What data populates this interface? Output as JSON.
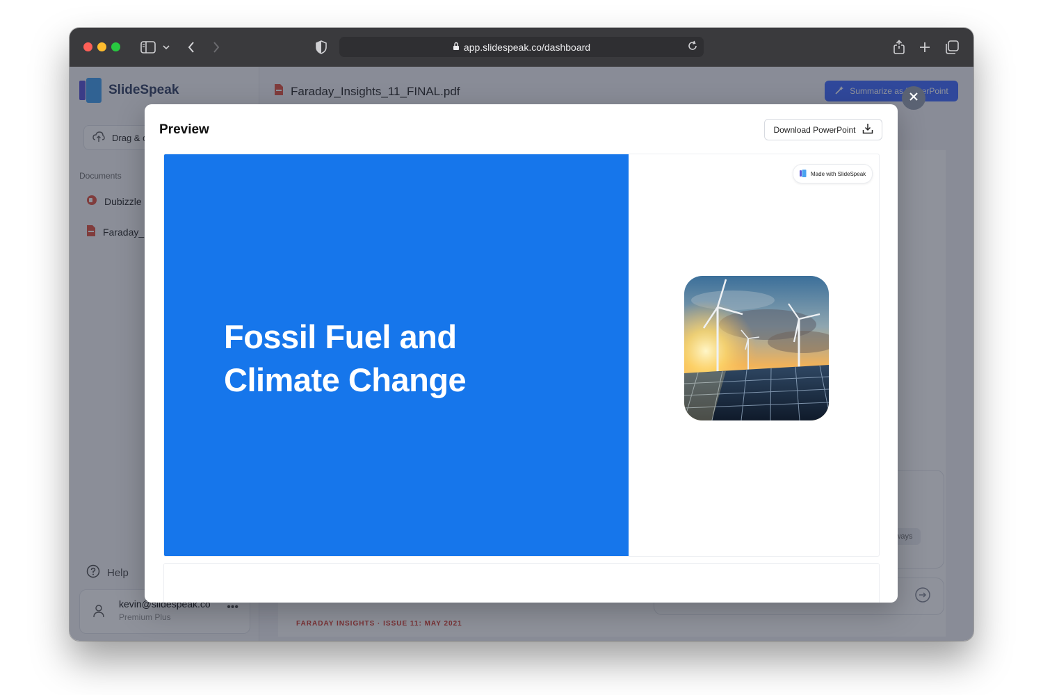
{
  "browser": {
    "url": "app.slidespeak.co/dashboard"
  },
  "sidebar": {
    "app_name": "SlideSpeak",
    "upload_label": "Drag & d",
    "documents_heading": "Documents",
    "documents": [
      {
        "name": "Dubizzle",
        "color": "#e25b4a"
      },
      {
        "name": "Faraday_",
        "color": "#e25b4a"
      }
    ],
    "help_label": "Help",
    "user": {
      "email": "kevin@slidespeak.co",
      "plan": "Premium Plus"
    }
  },
  "main": {
    "file_name": "Faraday_Insights_11_FINAL.pdf",
    "summarize_button": "Summarize as PowerPoint",
    "footer_text": "FARADAY INSIGHTS · ISSUE 11: MAY 2021",
    "chip_text": "ways"
  },
  "modal": {
    "title": "Preview",
    "download_button": "Download PowerPoint",
    "slide": {
      "title": "Fossil Fuel and Climate Change",
      "badge": "Made with SlideSpeak",
      "background_color": "#1676eb",
      "image": "wind-turbines-solar-panels-sunset"
    }
  }
}
